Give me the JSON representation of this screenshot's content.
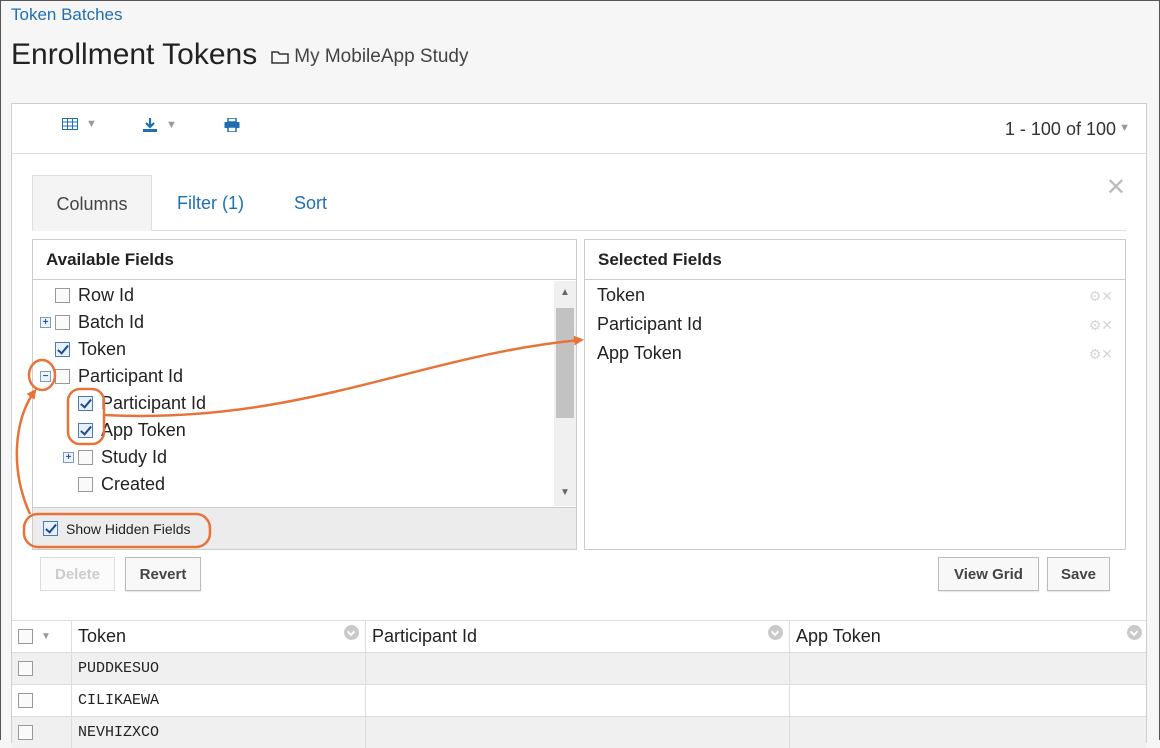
{
  "breadcrumb": "Token Batches",
  "header": {
    "title": "Enrollment Tokens",
    "folder": "My MobileApp Study"
  },
  "toolbar": {
    "paging": "1 - 100 of 100"
  },
  "tabs": {
    "columns": "Columns",
    "filter": "Filter (1)",
    "sort": "Sort"
  },
  "available": {
    "title": "Available Fields",
    "items": [
      "Row Id",
      "Batch Id",
      "Token",
      "Participant Id",
      "Participant Id",
      "App Token",
      "Study Id",
      "Created"
    ],
    "show_hidden": "Show Hidden Fields"
  },
  "selected": {
    "title": "Selected Fields",
    "items": [
      "Token",
      "Participant Id",
      "App Token"
    ]
  },
  "buttons": {
    "delete": "Delete",
    "revert": "Revert",
    "view_grid": "View Grid",
    "save": "Save"
  },
  "grid": {
    "columns": [
      "Token",
      "Participant Id",
      "App Token"
    ],
    "rows": [
      "PUDDKESUO",
      "CILIKAEWA",
      "NEVHIZXCO"
    ]
  },
  "colors": {
    "link": "#1f6fb2",
    "annotation": "#e8733a"
  }
}
